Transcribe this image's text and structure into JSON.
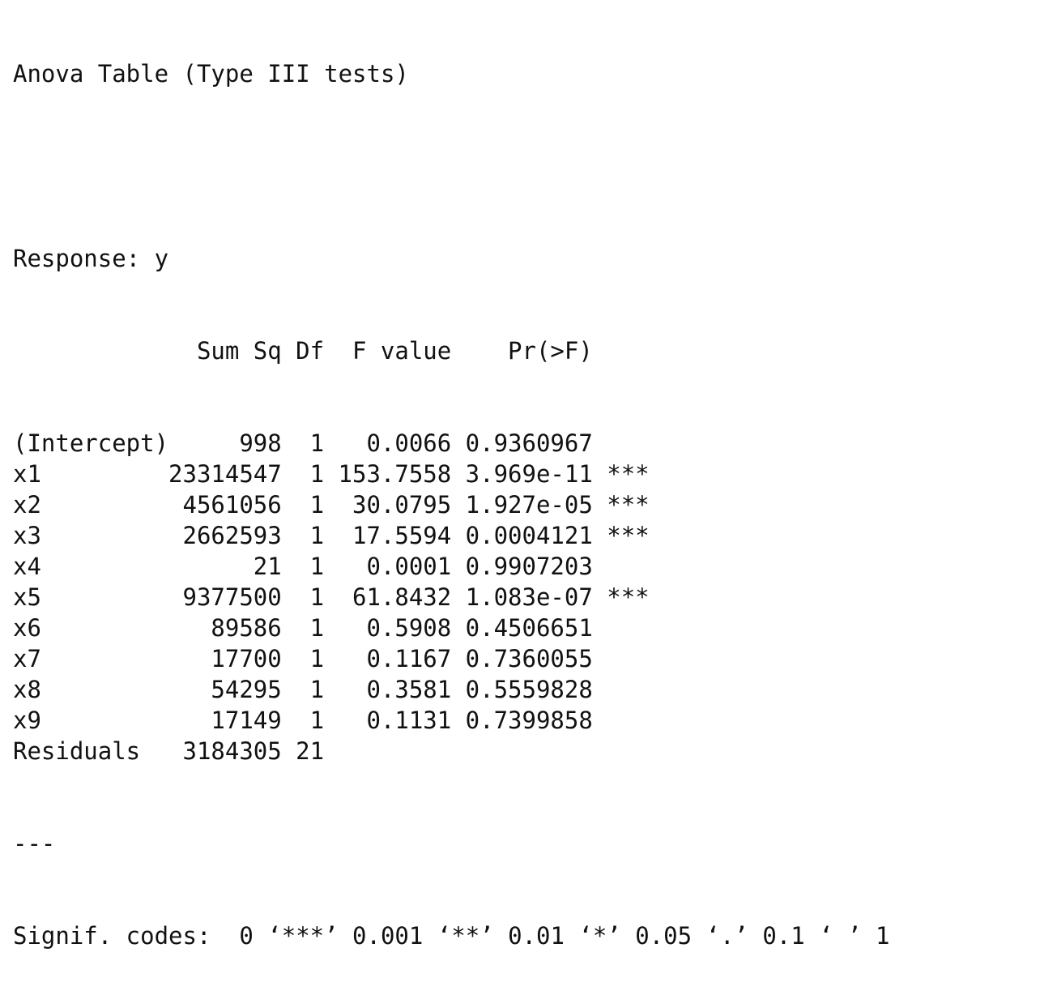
{
  "title": "Anova Table (Type III tests)",
  "response": "Response: y",
  "columns": [
    "Sum Sq",
    "Df",
    "F value",
    "Pr(>F)"
  ],
  "rows": [
    {
      "name": "(Intercept)",
      "sum_sq": "998",
      "df": "1",
      "f_value": "0.0066",
      "pr": "0.9360967",
      "sig": ""
    },
    {
      "name": "x1",
      "sum_sq": "23314547",
      "df": "1",
      "f_value": "153.7558",
      "pr": "3.969e-11",
      "sig": "***"
    },
    {
      "name": "x2",
      "sum_sq": "4561056",
      "df": "1",
      "f_value": "30.0795",
      "pr": "1.927e-05",
      "sig": "***"
    },
    {
      "name": "x3",
      "sum_sq": "2662593",
      "df": "1",
      "f_value": "17.5594",
      "pr": "0.0004121",
      "sig": "***"
    },
    {
      "name": "x4",
      "sum_sq": "21",
      "df": "1",
      "f_value": "0.0001",
      "pr": "0.9907203",
      "sig": ""
    },
    {
      "name": "x5",
      "sum_sq": "9377500",
      "df": "1",
      "f_value": "61.8432",
      "pr": "1.083e-07",
      "sig": "***"
    },
    {
      "name": "x6",
      "sum_sq": "89586",
      "df": "1",
      "f_value": "0.5908",
      "pr": "0.4506651",
      "sig": ""
    },
    {
      "name": "x7",
      "sum_sq": "17700",
      "df": "1",
      "f_value": "0.1167",
      "pr": "0.7360055",
      "sig": ""
    },
    {
      "name": "x8",
      "sum_sq": "54295",
      "df": "1",
      "f_value": "0.3581",
      "pr": "0.5559828",
      "sig": ""
    },
    {
      "name": "x9",
      "sum_sq": "17149",
      "df": "1",
      "f_value": "0.1131",
      "pr": "0.7399858",
      "sig": ""
    },
    {
      "name": "Residuals",
      "sum_sq": "3184305",
      "df": "21",
      "f_value": "",
      "pr": "",
      "sig": ""
    }
  ],
  "separator": "---",
  "signif_codes": "Signif. codes:  0 ‘***’ 0.001 ‘**’ 0.01 ‘*’ 0.05 ‘.’ 0.1 ‘ ’ 1"
}
